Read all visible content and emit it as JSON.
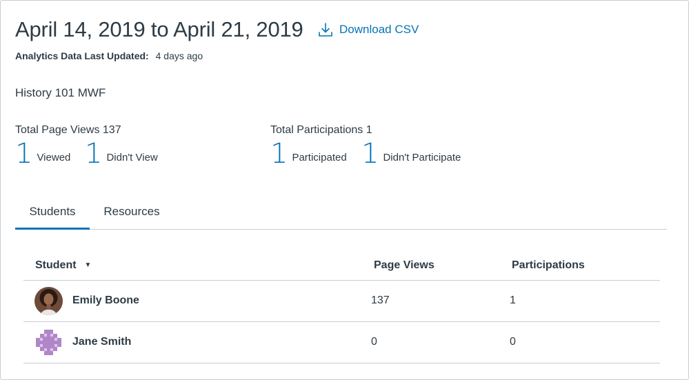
{
  "header": {
    "title": "April 14, 2019 to April 21, 2019",
    "download_label": "Download CSV",
    "updated_label": "Analytics Data Last Updated:",
    "updated_value": "4 days ago"
  },
  "course_name": "History 101 MWF",
  "page_views": {
    "heading": "Total Page Views 137",
    "viewed_count": "1",
    "viewed_label": "Viewed",
    "not_viewed_count": "1",
    "not_viewed_label": "Didn't View"
  },
  "participations": {
    "heading": "Total Participations 1",
    "participated_count": "1",
    "participated_label": "Participated",
    "not_participated_count": "1",
    "not_participated_label": "Didn't Participate"
  },
  "tabs": [
    {
      "label": "Students",
      "active": true
    },
    {
      "label": "Resources",
      "active": false
    }
  ],
  "table": {
    "columns": [
      "Student",
      "Page Views",
      "Participations"
    ],
    "sort_icon": "caret-down-icon",
    "rows": [
      {
        "name": "Emily Boone",
        "page_views": "137",
        "participations": "1",
        "avatar": "photo"
      },
      {
        "name": "Jane Smith",
        "page_views": "0",
        "participations": "0",
        "avatar": "pattern"
      }
    ]
  },
  "colors": {
    "accent": "#0374b5",
    "text": "#2d3b45",
    "border": "#c7cdd1",
    "avatar_pattern": "#b186c9"
  }
}
